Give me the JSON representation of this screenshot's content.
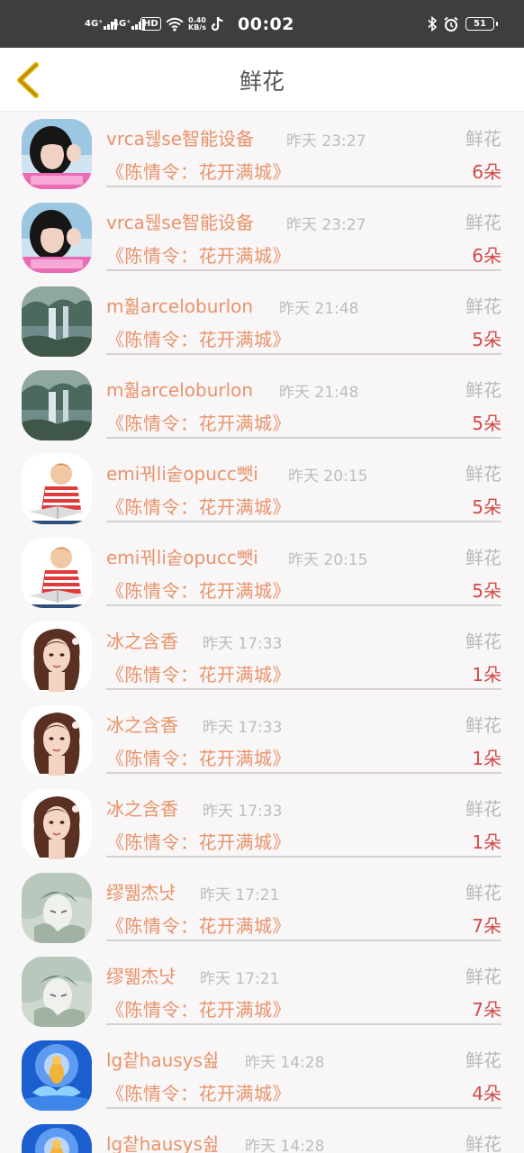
{
  "status_bar": {
    "signal1": "4G⁺",
    "signal2": "4G⁺",
    "hd_label": "HD",
    "net_speed_value": "0.40",
    "net_speed_unit": "KB/s",
    "time": "00:02",
    "battery": "51",
    "icons": [
      "signal-icon",
      "wifi-icon",
      "tiktok-icon",
      "bluetooth-icon",
      "alarm-icon",
      "battery-icon"
    ]
  },
  "header": {
    "title": "鲜花",
    "back_icon": "chevron-left-icon",
    "accent_color": "#e7b100"
  },
  "colors": {
    "name": "#e8936a",
    "gift_title": "#e8936a",
    "count": "#d24a4a",
    "muted": "#bdbdbd"
  },
  "items": [
    {
      "name": "vrca뒎se智能设备",
      "time": "昨天 23:27",
      "gift_type": "鲜花",
      "gift_title": "《陈情令：花开满城》",
      "count": "6朵",
      "avatar": "girl-photo-avatar"
    },
    {
      "name": "vrca뒎se智能设备",
      "time": "昨天 23:27",
      "gift_type": "鲜花",
      "gift_title": "《陈情令：花开满城》",
      "count": "6朵",
      "avatar": "girl-photo-avatar"
    },
    {
      "name": "m훪arceloburlon",
      "time": "昨天 21:48",
      "gift_type": "鲜花",
      "gift_title": "《陈情令：花开满城》",
      "count": "5朵",
      "avatar": "forest-waterfall-avatar"
    },
    {
      "name": "m훪arceloburlon",
      "time": "昨天 21:48",
      "gift_type": "鲜花",
      "gift_title": "《陈情令：花开满城》",
      "count": "5朵",
      "avatar": "forest-waterfall-avatar"
    },
    {
      "name": "emi꿔li숱opucc뺏i",
      "time": "昨天 20:15",
      "gift_type": "鲜花",
      "gift_title": "《陈情令：花开满城》",
      "count": "5朵",
      "avatar": "boy-reading-avatar"
    },
    {
      "name": "emi꿔li숱opucc뺏i",
      "time": "昨天 20:15",
      "gift_type": "鲜花",
      "gift_title": "《陈情令：花开满城》",
      "count": "5朵",
      "avatar": "boy-reading-avatar"
    },
    {
      "name": "冰之含香",
      "time": "昨天 17:33",
      "gift_type": "鲜花",
      "gift_title": "《陈情令：花开满城》",
      "count": "1朵",
      "avatar": "woman-portrait-avatar"
    },
    {
      "name": "冰之含香",
      "time": "昨天 17:33",
      "gift_type": "鲜花",
      "gift_title": "《陈情令：花开满城》",
      "count": "1朵",
      "avatar": "woman-portrait-avatar"
    },
    {
      "name": "冰之含香",
      "time": "昨天 17:33",
      "gift_type": "鲜花",
      "gift_title": "《陈情令：花开满城》",
      "count": "1朵",
      "avatar": "woman-portrait-avatar"
    },
    {
      "name": "缪뛞杰냣",
      "time": "昨天 17:21",
      "gift_type": "鲜花",
      "gift_title": "《陈情令：花开满城》",
      "count": "7朵",
      "avatar": "anime-drawing-avatar"
    },
    {
      "name": "缪뛞杰냣",
      "time": "昨天 17:21",
      "gift_type": "鲜花",
      "gift_title": "《陈情令：花开满城》",
      "count": "7朵",
      "avatar": "anime-drawing-avatar"
    },
    {
      "name": "lg챁hausys쉺",
      "time": "昨天 14:28",
      "gift_type": "鲜花",
      "gift_title": "《陈情令：花开满城》",
      "count": "4朵",
      "avatar": "buddha-lotus-avatar"
    },
    {
      "name": "lg챁hausys쉺",
      "time": "昨天 14:28",
      "gift_type": "鲜花",
      "gift_title": "",
      "count": "",
      "avatar": "buddha-lotus-avatar"
    }
  ]
}
